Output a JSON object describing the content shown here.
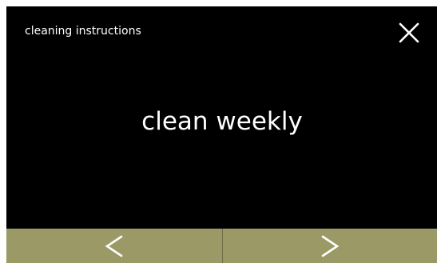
{
  "header": {
    "title": "cleaning instructions",
    "close_icon": "close-icon"
  },
  "main": {
    "message": "clean weekly"
  },
  "nav": {
    "prev_icon": "chevron-left-icon",
    "next_icon": "chevron-right-icon"
  },
  "colors": {
    "background": "#000000",
    "text": "#ffffff",
    "nav_button": "#9b9a67"
  }
}
